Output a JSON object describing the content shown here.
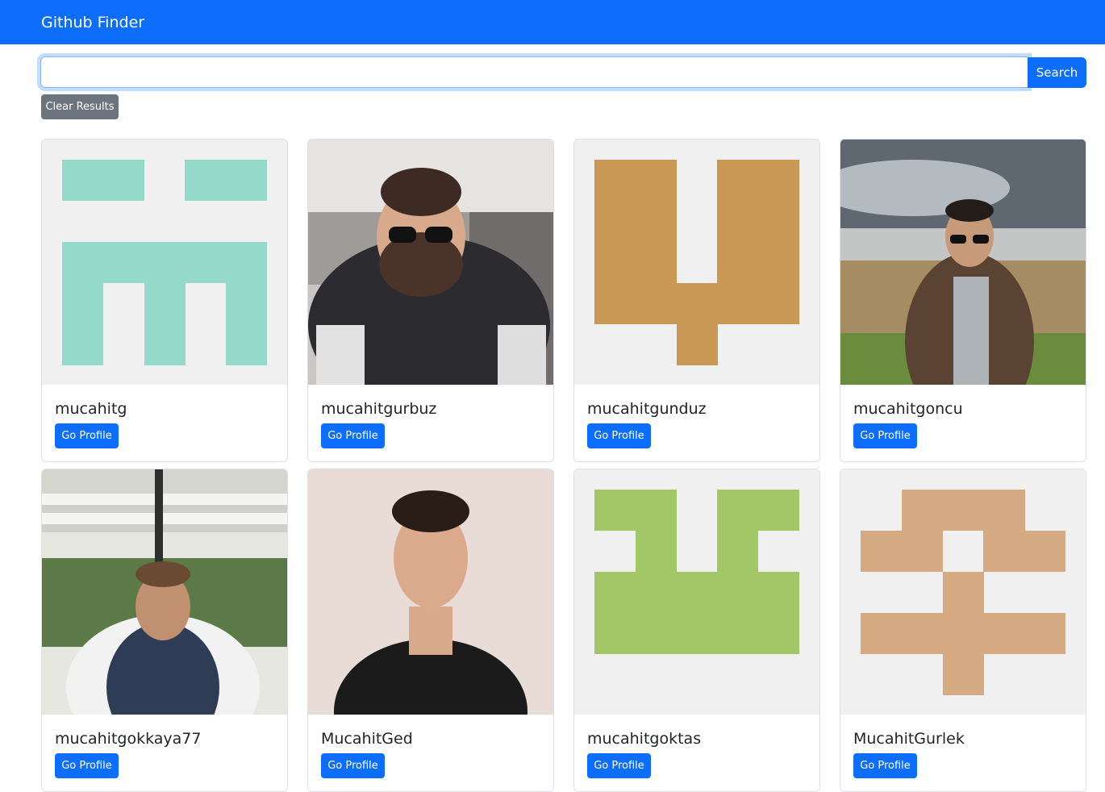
{
  "navbar": {
    "brand": "Github Finder"
  },
  "search": {
    "value": "",
    "placeholder": "",
    "button_label": "Search"
  },
  "clear_label": "Clear Results",
  "colors": {
    "navbar": "#0d6efd",
    "primary_button": "#0d6efd",
    "secondary_button": "#6c757d",
    "identicon_bg": "#f0f0f0"
  },
  "users": [
    {
      "login": "mucahitg",
      "button_label": "Go Profile",
      "avatar": "identicon",
      "avatar_color": "#94d9c9"
    },
    {
      "login": "mucahitgurbuz",
      "button_label": "Go Profile",
      "avatar": "photo",
      "avatar_color": ""
    },
    {
      "login": "mucahitgunduz",
      "button_label": "Go Profile",
      "avatar": "identicon",
      "avatar_color": "#c99854"
    },
    {
      "login": "mucahitgoncu",
      "button_label": "Go Profile",
      "avatar": "photo",
      "avatar_color": ""
    },
    {
      "login": "mucahitgokkaya77",
      "button_label": "Go Profile",
      "avatar": "photo",
      "avatar_color": ""
    },
    {
      "login": "MucahitGed",
      "button_label": "Go Profile",
      "avatar": "photo",
      "avatar_color": ""
    },
    {
      "login": "mucahitgoktas",
      "button_label": "Go Profile",
      "avatar": "identicon",
      "avatar_color": "#a3c767"
    },
    {
      "login": "MucahitGurlek",
      "button_label": "Go Profile",
      "avatar": "identicon",
      "avatar_color": "#d6ab84"
    }
  ]
}
